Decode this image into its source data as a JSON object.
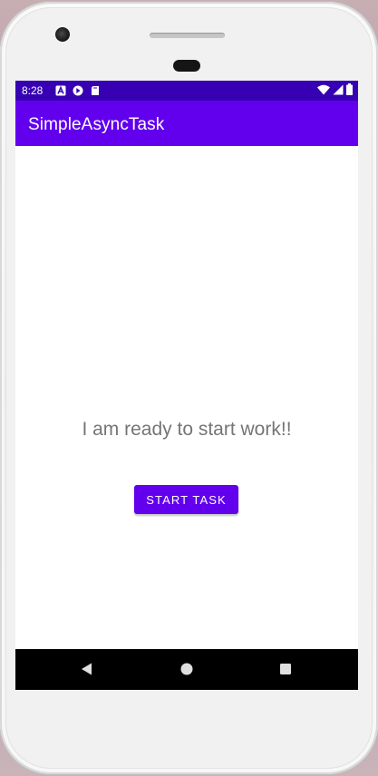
{
  "status_bar": {
    "time": "8:28",
    "notifications": [
      "a-icon",
      "google-play-icon",
      "sd-card-icon"
    ],
    "system": [
      "wifi-icon",
      "signal-icon",
      "battery-icon"
    ]
  },
  "app_bar": {
    "title": "SimpleAsyncTask"
  },
  "main": {
    "message": "I am ready to start work!!",
    "start_button_label": "START TASK"
  },
  "navigation": {
    "buttons": [
      "back-icon",
      "home-icon",
      "recents-icon"
    ]
  },
  "colors": {
    "status_bar": "#3700b3",
    "app_bar": "#6200ee",
    "accent": "#6200ee",
    "message_text": "#757575",
    "nav_bar": "#000000"
  }
}
